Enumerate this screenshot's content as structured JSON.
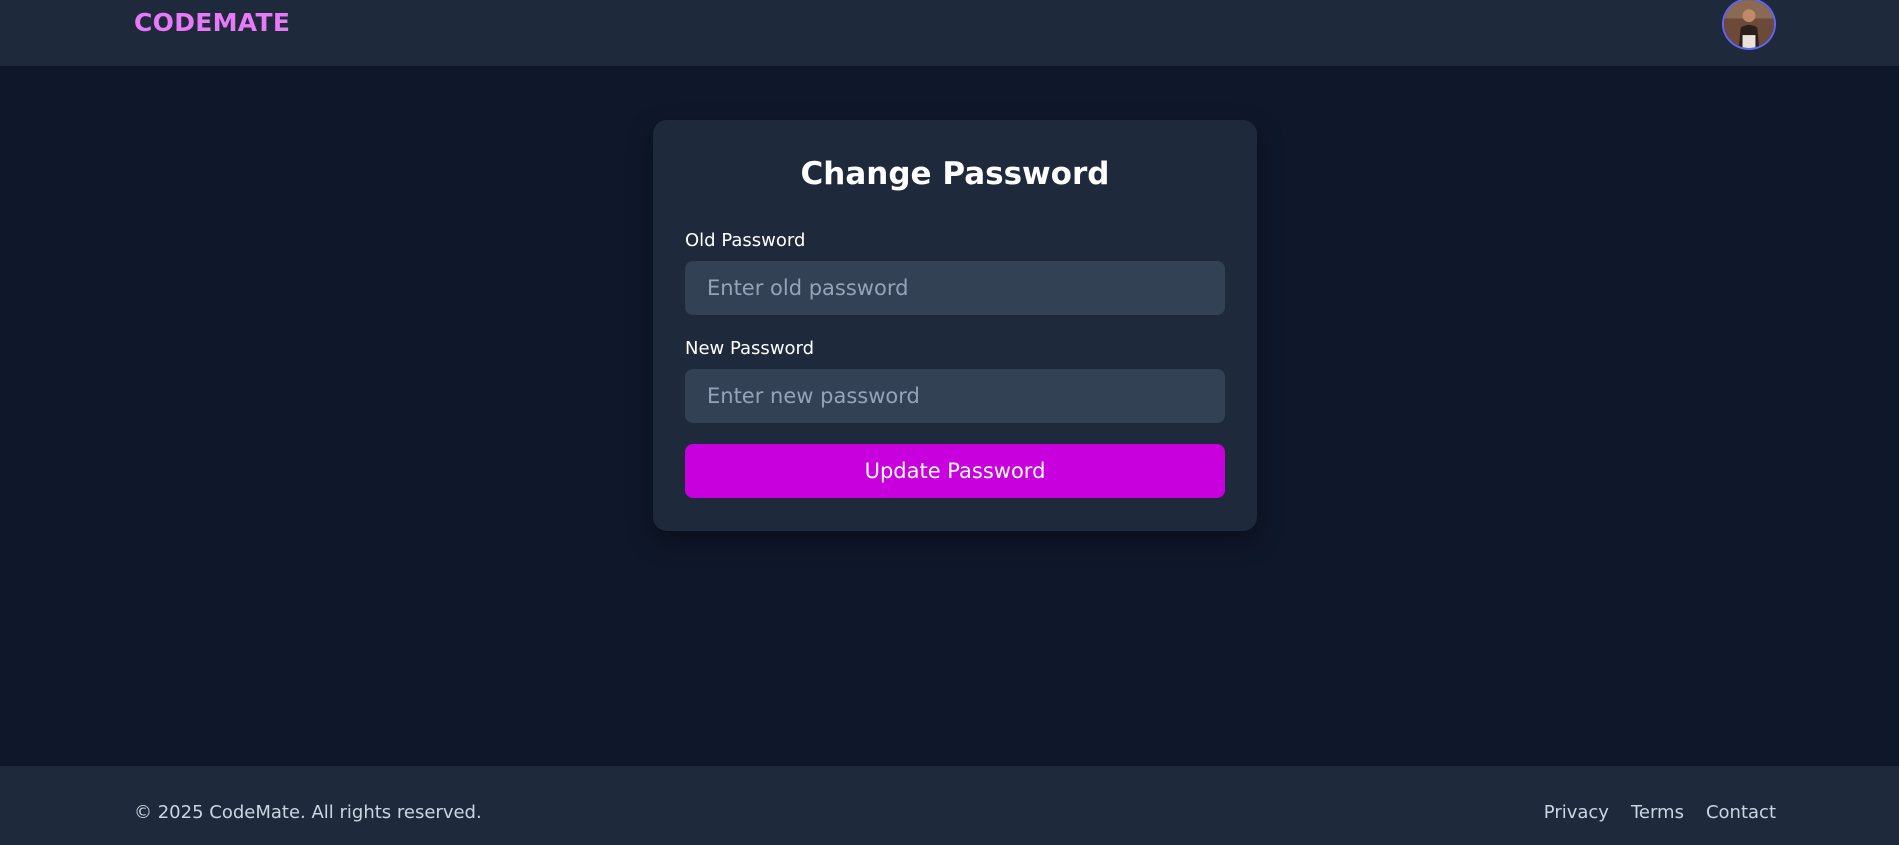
{
  "navbar": {
    "brand": "CODEMATE",
    "avatar_icon": "user-avatar-photo"
  },
  "form": {
    "title": "Change Password",
    "old_password": {
      "label": "Old Password",
      "placeholder": "Enter old password",
      "value": ""
    },
    "new_password": {
      "label": "New Password",
      "placeholder": "Enter new password",
      "value": ""
    },
    "submit_label": "Update Password"
  },
  "footer": {
    "copyright": "© 2025 CodeMate. All rights reserved.",
    "links": [
      "Privacy",
      "Terms",
      "Contact"
    ]
  },
  "colors": {
    "background": "#0f172a",
    "surface": "#1e293b",
    "input": "#334155",
    "brand": "#e879f9",
    "accent": "#c800de",
    "avatar_ring": "#6366f1"
  }
}
